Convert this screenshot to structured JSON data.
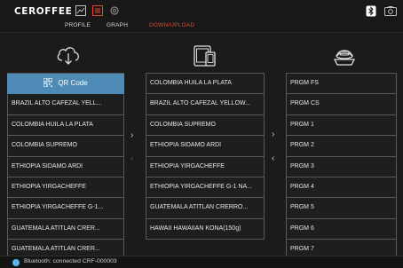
{
  "app": {
    "logo": "CEROFFEE"
  },
  "tabs": [
    {
      "label": "PROFILE"
    },
    {
      "label": "GRAPH"
    },
    {
      "label": "DOWN/UPLOAD"
    }
  ],
  "left_column": {
    "header": "QR Code",
    "items": [
      "BRAZIL ALTO CAFEZAL YELL...",
      "COLOMBIA HUILA LA PLATA",
      "COLOMBIA SUPREMO",
      "ETHIOPIA SIDAMO ARDI",
      "ETHIOPIA YIRGACHEFFE",
      "ETHIOPIA YIRGACHEFFE G-1...",
      "GUATEMALA ATITLAN CRER...",
      "GUATEMALA ATITLAN CRER..."
    ]
  },
  "middle_column": {
    "items": [
      "COLOMBIA HUILA LA PLATA",
      "BRAZIL ALTO CAFEZAL YELLOW...",
      "COLOMBIA SUPREMO",
      "ETHIOPIA SIDAMO ARDI",
      "ETHIOPIA YIRGACHEFFE",
      "ETHIOPIA YIRGACHEFFE G-1 NA...",
      "GUATEMALA ATITLAN CRERRO...",
      "HAWAII HAWAIIAN KONA(150g)"
    ]
  },
  "right_column": {
    "items": [
      "PRGM  FS",
      "PRGM  CS",
      "PRGM  1",
      "PRGM  2",
      "PRGM  3",
      "PRGM  4",
      "PRGM  5",
      "PRGM  6",
      "PRGM  7"
    ]
  },
  "status": {
    "text": "Bluetooth: connected   CRF-000003"
  },
  "colors": {
    "accent": "#e8452f",
    "header_blue": "#4d8ab5",
    "background": "#1b1b1b"
  }
}
